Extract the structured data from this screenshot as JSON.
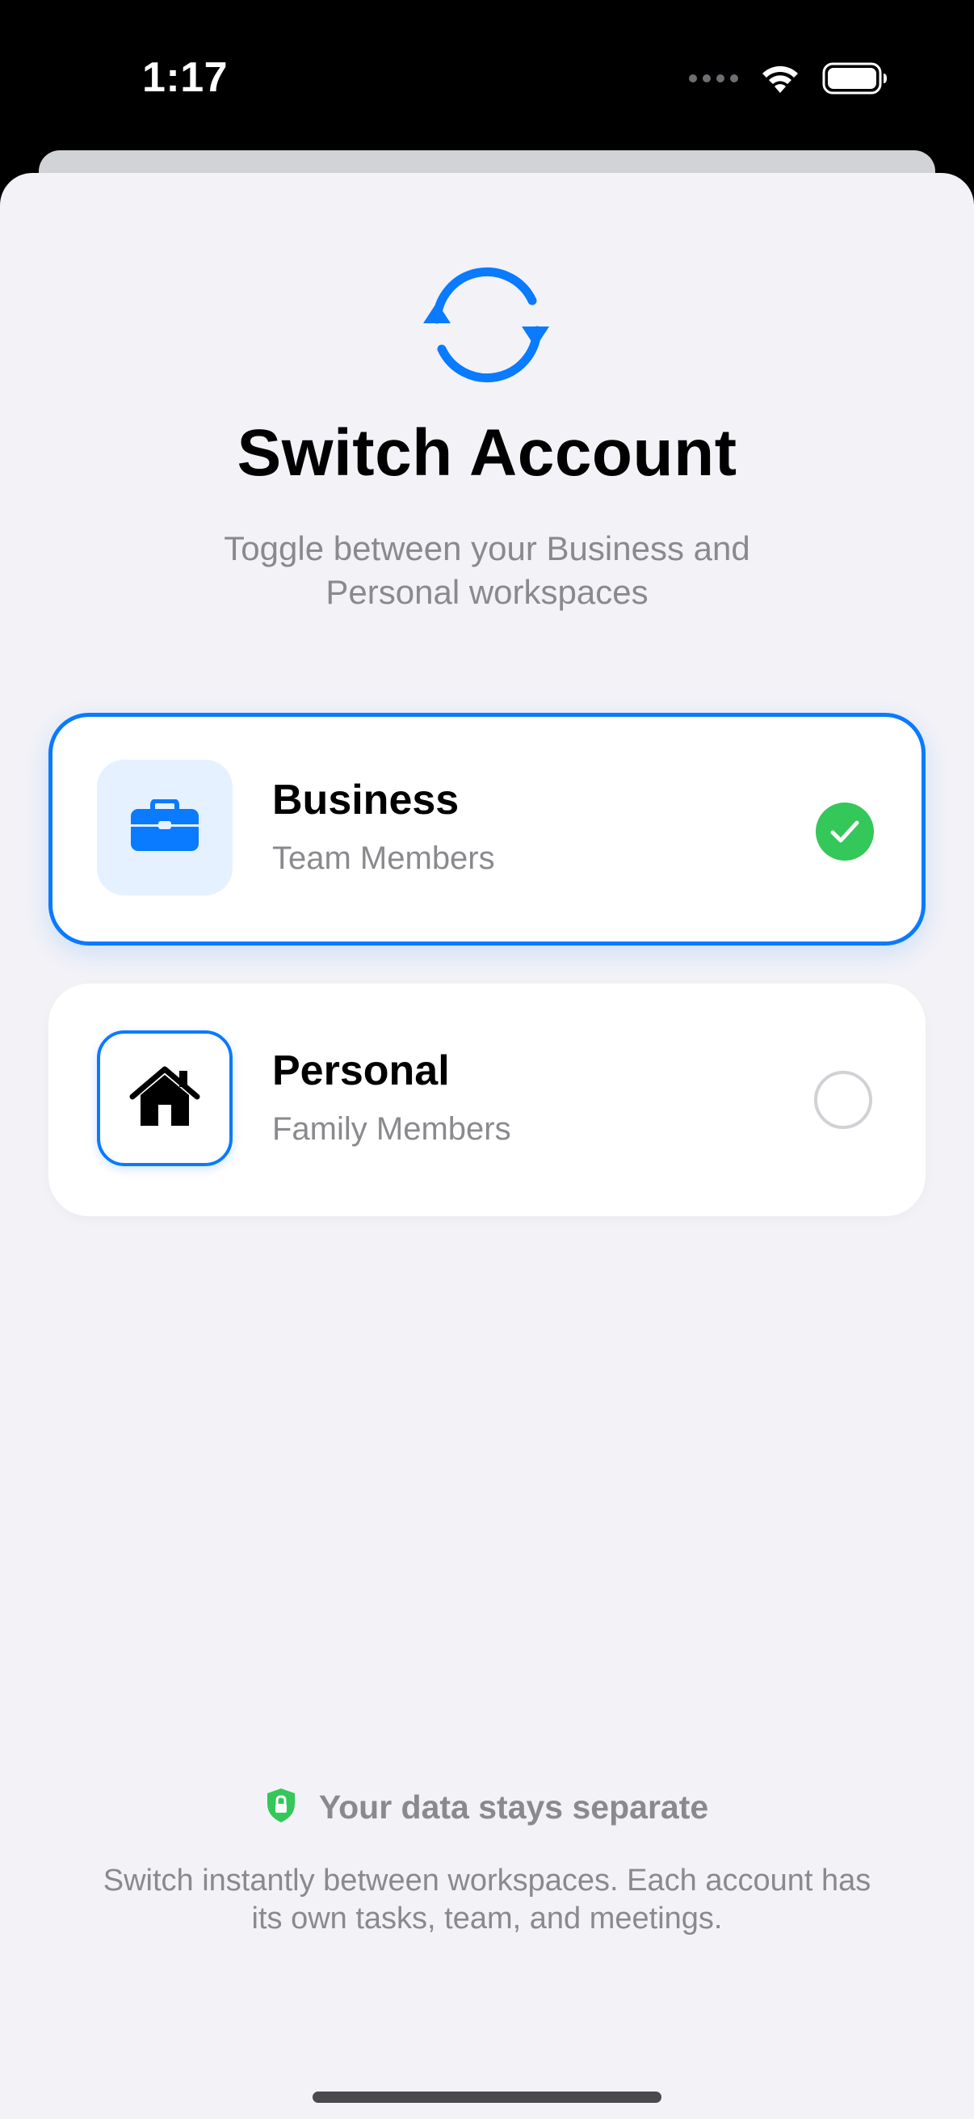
{
  "status_bar": {
    "time": "1:17",
    "icons": [
      "signal-dots-icon",
      "wifi-icon",
      "battery-icon"
    ]
  },
  "header": {
    "icon": "arrow-sync-icon",
    "title": "Switch Account",
    "subtitle": "Toggle between your Business and Personal workspaces"
  },
  "accounts": [
    {
      "name": "Business",
      "description": "Team Members",
      "icon": "briefcase-icon",
      "selected": true
    },
    {
      "name": "Personal",
      "description": "Family Members",
      "icon": "house-icon",
      "selected": false
    }
  ],
  "footer": {
    "icon": "lock-shield-icon",
    "title": "Your data stays separate",
    "body": "Switch instantly between workspaces. Each account has its own tasks, team, and meetings."
  },
  "colors": {
    "accent": "#0a7aff",
    "success": "#34c759",
    "background": "#f2f2f7",
    "secondary_text": "#8a8a8e"
  }
}
